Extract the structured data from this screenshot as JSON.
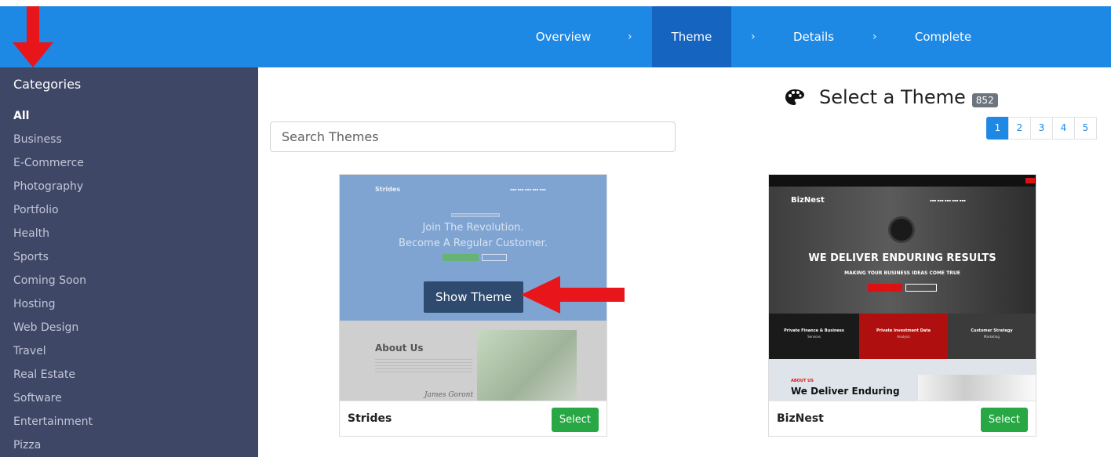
{
  "wizard": {
    "steps": [
      {
        "label": "Overview"
      },
      {
        "label": "Theme"
      },
      {
        "label": "Details"
      },
      {
        "label": "Complete"
      }
    ],
    "separator": "›",
    "active_step": "Theme"
  },
  "sidebar": {
    "title": "Categories",
    "items": [
      {
        "label": "All"
      },
      {
        "label": "Business"
      },
      {
        "label": "E-Commerce"
      },
      {
        "label": "Photography"
      },
      {
        "label": "Portfolio"
      },
      {
        "label": "Health"
      },
      {
        "label": "Sports"
      },
      {
        "label": "Coming Soon"
      },
      {
        "label": "Hosting"
      },
      {
        "label": "Web Design"
      },
      {
        "label": "Travel"
      },
      {
        "label": "Real Estate"
      },
      {
        "label": "Software"
      },
      {
        "label": "Entertainment"
      },
      {
        "label": "Pizza"
      }
    ],
    "active_item": "All"
  },
  "main": {
    "title": "Select a Theme",
    "count": "852",
    "title_icon": "palette-icon",
    "search": {
      "placeholder": "Search Themes"
    },
    "pagination": [
      "1",
      "2",
      "3",
      "4",
      "5"
    ],
    "active_page": "1"
  },
  "themes": [
    {
      "name": "Strides",
      "select_label": "Select",
      "hover_label": "Show Theme",
      "preview": {
        "brand": "Strides",
        "headline_1": "Join The Revolution.",
        "headline_2": "Become A Regular Customer.",
        "about_title": "About Us",
        "signature": "James Goront"
      }
    },
    {
      "name": "BizNest",
      "select_label": "Select",
      "preview": {
        "brand": "BizNest",
        "headline": "WE DELIVER  ENDURING RESULTS",
        "subheadline": "MAKING YOUR BUSINESS  IDEAS COME TRUE",
        "boxes": [
          {
            "title": "Private Finance & Business",
            "sub": "Services"
          },
          {
            "title": "Private Investment Data",
            "sub": "Analysis"
          },
          {
            "title": "Customer Strategy",
            "sub": "Marketing"
          }
        ],
        "about_label": "ABOUT US",
        "about_heading": "We Deliver Enduring"
      }
    }
  ],
  "colors": {
    "navbar": "#1e88e5",
    "navbar_active": "#1565c0",
    "sidebar": "#3f4767",
    "select_button": "#28a745",
    "annotation_arrow": "#e8151b"
  }
}
